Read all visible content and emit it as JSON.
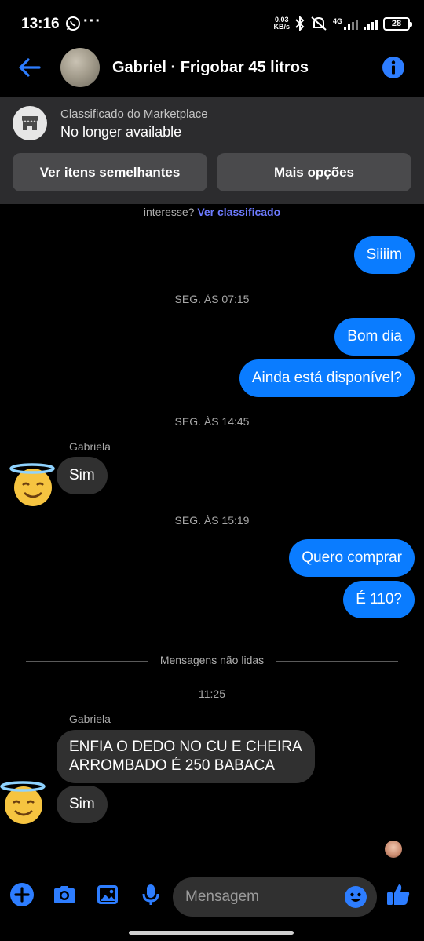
{
  "status_bar": {
    "time": "13:16",
    "net_speed_value": "0.03",
    "net_speed_unit": "KB/s",
    "network": "4G",
    "battery": "28"
  },
  "header": {
    "title": "Gabriel · Frigobar 45 litros",
    "back_icon": "arrow-left-icon",
    "info_icon": "info-icon"
  },
  "marketplace": {
    "label": "Classificado do Marketplace",
    "status": "No longer available",
    "btn_similar": "Ver itens semelhantes",
    "btn_more": "Mais opções"
  },
  "chat": {
    "notice_prefix": "interesse?",
    "notice_link": "Ver classificado",
    "messages": [
      {
        "text": "Siiiim"
      },
      {
        "timestamp": "SEG. ÀS 07:15"
      },
      {
        "text": "Bom dia"
      },
      {
        "text": "Ainda está disponível?"
      },
      {
        "timestamp": "SEG. ÀS 14:45"
      },
      {
        "sender": "Gabriela"
      },
      {
        "text": "Sim"
      },
      {
        "timestamp": "SEG. ÀS 15:19"
      },
      {
        "text": "Quero comprar"
      },
      {
        "text": "É 110?"
      },
      {
        "unread": "Mensagens não lidas"
      },
      {
        "timestamp": "11:25"
      },
      {
        "sender": "Gabriela"
      },
      {
        "text_line1": "ENFIA O DEDO NO CU E CHEIRA",
        "text_line2": "ARROMBADO É 250 BABACA"
      },
      {
        "text": "Sim"
      }
    ]
  },
  "composer": {
    "placeholder": "Mensagem",
    "icons": [
      "plus-icon",
      "camera-icon",
      "image-icon",
      "microphone-icon",
      "emoji-icon",
      "thumbs-up-icon"
    ]
  },
  "colors": {
    "accent": "#0a7cff",
    "incoming_bubble": "#303030",
    "banner_bg": "#2c2c2e"
  }
}
